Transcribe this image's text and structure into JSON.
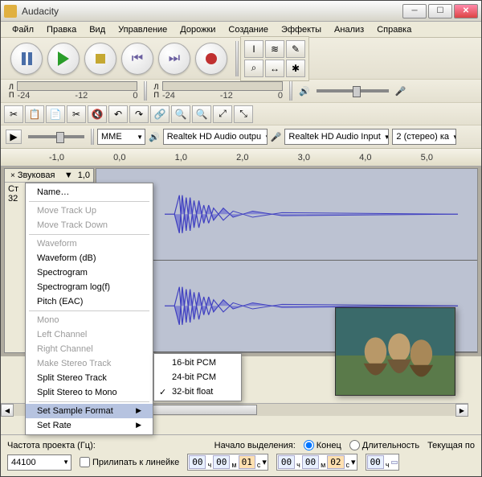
{
  "window": {
    "title": "Audacity"
  },
  "menu": [
    "Файл",
    "Правка",
    "Вид",
    "Управление",
    "Дорожки",
    "Создание",
    "Эффекты",
    "Анализ",
    "Справка"
  ],
  "tools": {
    "selection": "I",
    "envelope": "≋",
    "draw": "✎",
    "zoom": "⌕",
    "timeshift": "↔",
    "multi": "✱"
  },
  "meters": {
    "left_label": "Л\nП",
    "ticks": [
      "-24",
      "-12",
      "0"
    ]
  },
  "edit_icons": [
    "✂",
    "📋",
    "📄",
    "✂",
    "🔇",
    "↶",
    "↷",
    "🔗",
    "🔍",
    "🔍",
    "🔍",
    "🔍"
  ],
  "devices": {
    "play_speed": "▶",
    "host": "MME",
    "output": "Realtek HD Audio outpu",
    "input": "Realtek HD Audio Input",
    "channels": "2 (стерео) ка"
  },
  "timeline": {
    "marks": [
      "-1,0",
      "0,0",
      "1,0",
      "2,0",
      "3,0",
      "4,0",
      "5,0"
    ]
  },
  "track": {
    "close": "×",
    "name": "Звуковая",
    "dropdown": "▼",
    "amp": "1,0",
    "info1": "Ст",
    "info2": "32"
  },
  "ctx": {
    "name": "Name…",
    "move_up": "Move Track Up",
    "move_down": "Move Track Down",
    "waveform": "Waveform",
    "waveform_db": "Waveform (dB)",
    "spectrogram": "Spectrogram",
    "spectrogram_log": "Spectrogram log(f)",
    "pitch": "Pitch (EAC)",
    "mono": "Mono",
    "left": "Left Channel",
    "right": "Right Channel",
    "make_stereo": "Make Stereo Track",
    "split_stereo": "Split Stereo Track",
    "split_mono": "Split Stereo to Mono",
    "set_format": "Set Sample Format",
    "set_rate": "Set Rate"
  },
  "submenu": {
    "pcm16": "16-bit PCM",
    "pcm24": "24-bit PCM",
    "float32": "32-bit float"
  },
  "status": {
    "proj_rate_label": "Частота проекта (Гц):",
    "proj_rate": "44100",
    "snap_label": "Прилипать к линейке",
    "sel_start_label": "Начало выделения:",
    "end_label": "Конец",
    "dur_label": "Длительность",
    "pos_label": "Текущая по",
    "tc1": {
      "h": "00",
      "m": "00",
      "s": "01",
      "cs": "с"
    },
    "tc2": {
      "h": "00",
      "m": "00",
      "s": "02",
      "cs": "с"
    },
    "tc3": {
      "h": "00",
      "m": ""
    }
  }
}
